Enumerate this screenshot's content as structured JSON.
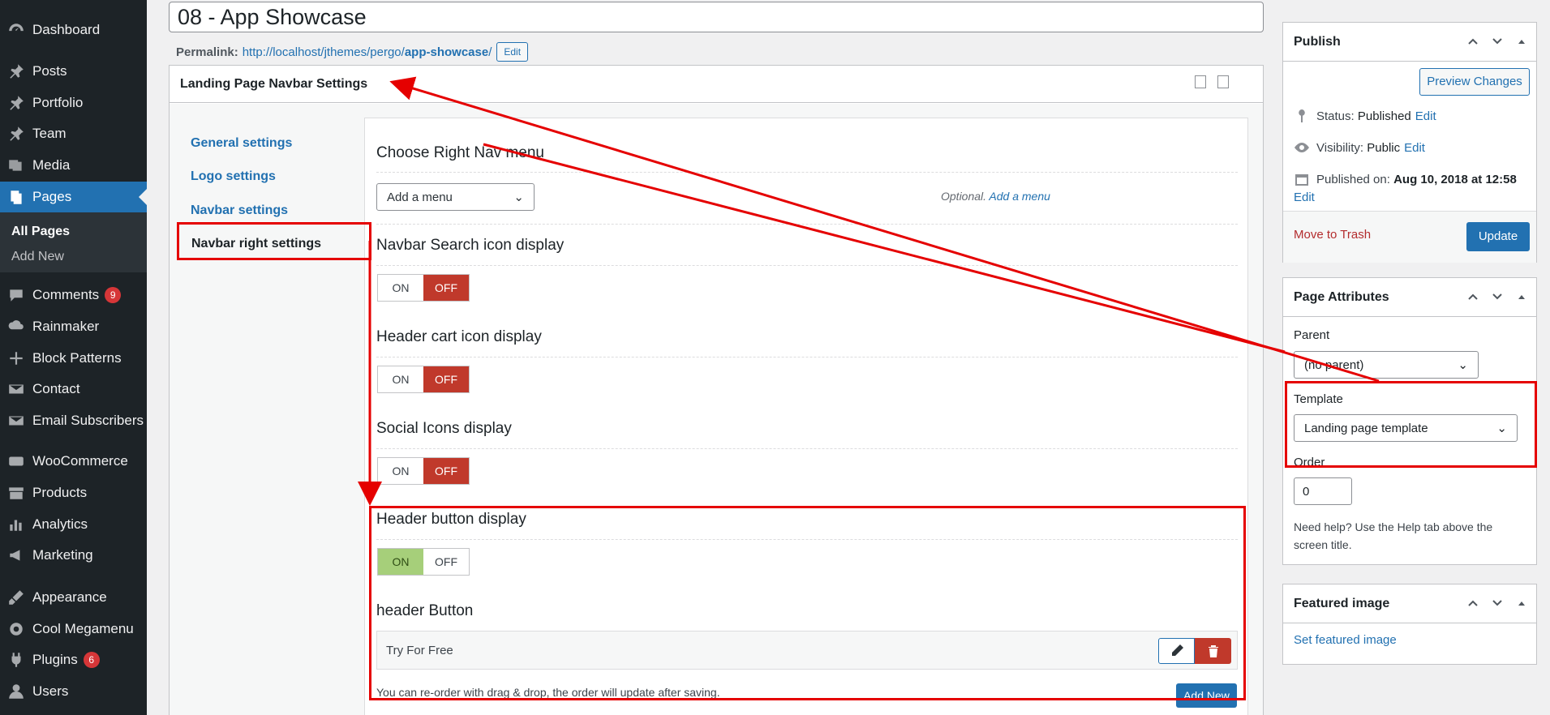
{
  "sidebar": {
    "items": [
      {
        "label": "Dashboard",
        "icon": "dashboard-icon"
      },
      {
        "label": "Posts",
        "icon": "pin-icon"
      },
      {
        "label": "Portfolio",
        "icon": "pin-icon"
      },
      {
        "label": "Team",
        "icon": "pin-icon"
      },
      {
        "label": "Media",
        "icon": "media-icon"
      },
      {
        "label": "Pages",
        "icon": "pages-icon"
      },
      {
        "label": "Comments",
        "icon": "comment-icon",
        "badge": "9"
      },
      {
        "label": "Rainmaker",
        "icon": "cloud-icon"
      },
      {
        "label": "Block Patterns",
        "icon": "plus-icon"
      },
      {
        "label": "Contact",
        "icon": "mail-icon"
      },
      {
        "label": "Email Subscribers",
        "icon": "mail-icon"
      },
      {
        "label": "WooCommerce",
        "icon": "woo-icon"
      },
      {
        "label": "Products",
        "icon": "archive-icon"
      },
      {
        "label": "Analytics",
        "icon": "chart-icon"
      },
      {
        "label": "Marketing",
        "icon": "megaphone-icon"
      },
      {
        "label": "Appearance",
        "icon": "brush-icon"
      },
      {
        "label": "Cool Megamenu",
        "icon": "gear-icon"
      },
      {
        "label": "Plugins",
        "icon": "plug-icon",
        "badge": "6"
      },
      {
        "label": "Users",
        "icon": "user-icon"
      }
    ],
    "submenu": {
      "all_pages": "All Pages",
      "add_new": "Add New"
    }
  },
  "editor": {
    "title": "08 - App Showcase",
    "permalink_label": "Permalink:",
    "permalink_base": "http://localhost/jthemes/pergo/",
    "permalink_slug": "app-showcase",
    "permalink_trail": "/",
    "edit_label": "Edit"
  },
  "metabox": {
    "title": "Landing Page Navbar Settings",
    "tabs": [
      "General settings",
      "Logo settings",
      "Navbar settings",
      "Navbar right settings"
    ],
    "fields": {
      "right_nav_title": "Choose Right Nav menu",
      "menu_select_value": "Add a menu",
      "optional_prefix": "Optional.",
      "optional_link": "Add a menu",
      "search_icon_title": "Navbar Search icon display",
      "cart_icon_title": "Header cart icon display",
      "social_icons_title": "Social Icons display",
      "header_button_title": "Header button display",
      "header_button_list_title": "header Button",
      "on": "ON",
      "off": "OFF",
      "button_item": "Try For Free",
      "reorder_note": "You can re-order with drag & drop, the order will update after saving.",
      "add_new": "Add New"
    }
  },
  "publish": {
    "title": "Publish",
    "preview": "Preview Changes",
    "status_label": "Status:",
    "status_value": "Published",
    "visibility_label": "Visibility:",
    "visibility_value": "Public",
    "published_label": "Published on:",
    "published_value": "Aug 10, 2018 at 12:58",
    "edit": "Edit",
    "trash": "Move to Trash",
    "update": "Update"
  },
  "attributes": {
    "title": "Page Attributes",
    "parent_label": "Parent",
    "parent_value": "(no parent)",
    "template_label": "Template",
    "template_value": "Landing page template",
    "order_label": "Order",
    "order_value": "0",
    "help": "Need help? Use the Help tab above the screen title."
  },
  "featured": {
    "title": "Featured image",
    "set_link": "Set featured image"
  },
  "colors": {
    "sidebar": "#1d2327",
    "accent": "#2271b1",
    "annotation": "#e50000",
    "off": "#c0392b",
    "on": "#a6cf7a"
  }
}
